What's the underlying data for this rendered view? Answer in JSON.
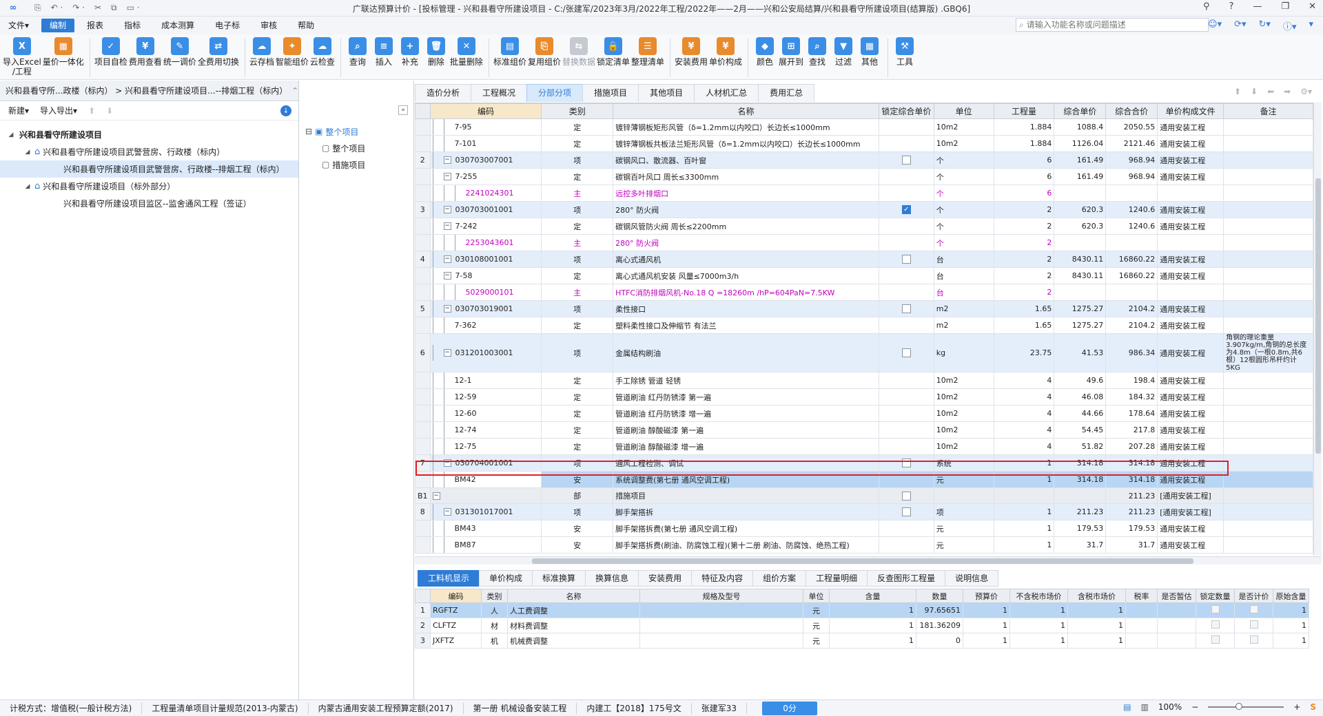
{
  "titlebar": {
    "title": "广联达预算计价 - [投标管理 - 兴和县看守所建设项目 - C:/张建军/2023年3月/2022年工程/2022年——2月——兴和公安局结算/兴和县看守所建设项目(结算版) .GBQ6]",
    "quick_access": [
      "⎘",
      "↶ ·",
      "↷ ·",
      "✂",
      "⧉",
      "▭ ·"
    ],
    "window_buttons": [
      "⚲",
      "?",
      "—",
      "❐",
      "✕"
    ]
  },
  "menu": {
    "items": [
      "文件▾",
      "编制",
      "报表",
      "指标",
      "成本测算",
      "电子标",
      "审核",
      "帮助"
    ],
    "active_index": 1
  },
  "search": {
    "placeholder": "请输入功能名称或问题描述"
  },
  "top_icons": [
    "☺▾",
    "⟳▾",
    "↻▾",
    "ⓘ▾",
    "▾"
  ],
  "toolbar": {
    "buttons": [
      {
        "label": "导入Excel\n/工程",
        "icon": "X",
        "color": "#3a8ee6"
      },
      {
        "label": "量价一体化",
        "icon": "▦",
        "color": "#e98a2c"
      },
      {
        "sep": true
      },
      {
        "label": "项目自检",
        "icon": "✓",
        "color": "#3a8ee6"
      },
      {
        "label": "费用查看",
        "icon": "¥",
        "color": "#3a8ee6"
      },
      {
        "label": "统一调价",
        "icon": "✎",
        "color": "#3a8ee6"
      },
      {
        "label": "全费用切换",
        "icon": "⇄",
        "color": "#3a8ee6"
      },
      {
        "sep": true
      },
      {
        "label": "云存档",
        "icon": "☁",
        "color": "#3a8ee6"
      },
      {
        "label": "智能组价",
        "icon": "✦",
        "color": "#e98a2c"
      },
      {
        "label": "云检查",
        "icon": "☁",
        "color": "#3a8ee6"
      },
      {
        "sep": true
      },
      {
        "label": "查询",
        "icon": "⌕",
        "color": "#3a8ee6"
      },
      {
        "label": "插入",
        "icon": "≡",
        "color": "#3a8ee6"
      },
      {
        "label": "补充",
        "icon": "+",
        "color": "#3a8ee6"
      },
      {
        "label": "删除",
        "icon": "🗑",
        "color": "#3a8ee6"
      },
      {
        "label": "批量删除",
        "icon": "✕",
        "color": "#3a8ee6"
      },
      {
        "sep": true
      },
      {
        "label": "标准组价",
        "icon": "▤",
        "color": "#3a8ee6"
      },
      {
        "label": "复用组价",
        "icon": "⎘",
        "color": "#e98a2c"
      },
      {
        "label": "替换数据",
        "icon": "⇆",
        "color": "#c5cad2",
        "disabled": true
      },
      {
        "label": "锁定清单",
        "icon": "🔒",
        "color": "#3a8ee6"
      },
      {
        "label": "整理清单",
        "icon": "☰",
        "color": "#e98a2c"
      },
      {
        "sep": true
      },
      {
        "label": "安装费用",
        "icon": "¥",
        "color": "#e98a2c"
      },
      {
        "label": "单价构成",
        "icon": "¥",
        "color": "#e98a2c"
      },
      {
        "sep": true
      },
      {
        "label": "颜色",
        "icon": "◆",
        "color": "#3a8ee6"
      },
      {
        "label": "展开到",
        "icon": "⊞",
        "color": "#3a8ee6"
      },
      {
        "label": "查找",
        "icon": "⌕",
        "color": "#3a8ee6"
      },
      {
        "label": "过滤",
        "icon": "▼",
        "color": "#3a8ee6"
      },
      {
        "label": "其他",
        "icon": "▦",
        "color": "#3a8ee6"
      },
      {
        "sep": true
      },
      {
        "label": "工具",
        "icon": "⚒",
        "color": "#3a8ee6"
      }
    ]
  },
  "left_panel": {
    "breadcrumb": "兴和县看守所...政楼（标内） > 兴和县看守所建设项目...--排烟工程（标内）",
    "toolbar": [
      "新建▾",
      "导入导出▾",
      "⬆",
      "⬇"
    ],
    "tree": [
      {
        "label": "兴和县看守所建设项目",
        "level": 0,
        "toggle": "◢",
        "icon": "",
        "bold": true
      },
      {
        "label": "兴和县看守所建设项目武警营房、行政楼（标内）",
        "level": 1,
        "toggle": "◢",
        "icon": "⌂"
      },
      {
        "label": "兴和县看守所建设项目武警营房、行政楼--排烟工程（标内）",
        "level": 2,
        "toggle": "",
        "icon": "",
        "selected": true
      },
      {
        "label": "兴和县看守所建设项目（标外部分）",
        "level": 1,
        "toggle": "◢",
        "icon": "⌂"
      },
      {
        "label": "兴和县看守所建设项目监区--监舍通风工程（签证）",
        "level": 2,
        "toggle": "",
        "icon": ""
      }
    ]
  },
  "nav_panel": {
    "collapse": "«",
    "items": [
      {
        "label": "整个项目",
        "level": 0,
        "toggle": "⊟",
        "active": true
      },
      {
        "label": "整个项目",
        "level": 1
      },
      {
        "label": "措施项目",
        "level": 1
      }
    ]
  },
  "main_tabs": [
    "造价分析",
    "工程概况",
    "分部分项",
    "措施项目",
    "其他项目",
    "人材机汇总",
    "费用汇总"
  ],
  "main_tabs_active": 2,
  "tab_right_icons": [
    "⬆",
    "⬇",
    "⬅",
    "➡",
    "⚙▾"
  ],
  "grid": {
    "columns": [
      "",
      "编码",
      "类别",
      "名称",
      "锁定综合单价",
      "单位",
      "工程量",
      "综合单价",
      "综合合价",
      "单价构成文件",
      "备注"
    ],
    "rows": [
      {
        "no": "",
        "code": "7-95",
        "kind": "定",
        "name": "镀锌薄钢板矩形风管（δ=1.2mm以内咬口）长边长≤1000mm",
        "lock": null,
        "unit": "10m2",
        "qty": "1.884",
        "price": "1088.4",
        "total": "2050.55",
        "file": "通用安装工程",
        "note": "",
        "type": "de",
        "indent": 2
      },
      {
        "no": "",
        "code": "7-101",
        "kind": "定",
        "name": "镀锌薄钢板共板法兰矩形风管（δ=1.2mm以内咬口）长边长≤1000mm",
        "lock": null,
        "unit": "10m2",
        "qty": "1.884",
        "price": "1126.04",
        "total": "2121.46",
        "file": "通用安装工程",
        "note": "",
        "type": "de",
        "indent": 2
      },
      {
        "no": "2",
        "code": "030703007001",
        "kind": "项",
        "name": "碳钢风口、散流器、百叶窗",
        "lock": false,
        "unit": "个",
        "qty": "6",
        "price": "161.49",
        "total": "968.94",
        "file": "通用安装工程",
        "note": "",
        "type": "qd",
        "indent": 1
      },
      {
        "no": "",
        "code": "7-255",
        "kind": "定",
        "name": "碳钢百叶风口 周长≤3300mm",
        "lock": null,
        "unit": "个",
        "qty": "6",
        "price": "161.49",
        "total": "968.94",
        "file": "通用安装工程",
        "note": "",
        "type": "de",
        "indent": 2,
        "box": true
      },
      {
        "no": "",
        "code": "2241024301",
        "kind": "主",
        "name": "远控多叶排烟口",
        "lock": null,
        "unit": "个",
        "qty": "6",
        "price": "",
        "total": "",
        "file": "",
        "note": "",
        "type": "main",
        "indent": 3
      },
      {
        "no": "3",
        "code": "030703001001",
        "kind": "项",
        "name": "280° 防火阀",
        "lock": true,
        "unit": "个",
        "qty": "2",
        "price": "620.3",
        "total": "1240.6",
        "file": "通用安装工程",
        "note": "",
        "type": "qd",
        "indent": 1
      },
      {
        "no": "",
        "code": "7-242",
        "kind": "定",
        "name": "碳钢风管防火阀 周长≤2200mm",
        "lock": null,
        "unit": "个",
        "qty": "2",
        "price": "620.3",
        "total": "1240.6",
        "file": "通用安装工程",
        "note": "",
        "type": "de",
        "indent": 2,
        "box": true
      },
      {
        "no": "",
        "code": "2253043601",
        "kind": "主",
        "name": "280° 防火阀",
        "lock": null,
        "unit": "个",
        "qty": "2",
        "price": "",
        "total": "",
        "file": "",
        "note": "",
        "type": "main",
        "indent": 3
      },
      {
        "no": "4",
        "code": "030108001001",
        "kind": "项",
        "name": "离心式通风机",
        "lock": false,
        "unit": "台",
        "qty": "2",
        "price": "8430.11",
        "total": "16860.22",
        "file": "通用安装工程",
        "note": "",
        "type": "qd",
        "indent": 1
      },
      {
        "no": "",
        "code": "7-58",
        "kind": "定",
        "name": "离心式通风机安装 风量≤7000m3/h",
        "lock": null,
        "unit": "台",
        "qty": "2",
        "price": "8430.11",
        "total": "16860.22",
        "file": "通用安装工程",
        "note": "",
        "type": "de",
        "indent": 2,
        "box": true
      },
      {
        "no": "",
        "code": "5029000101",
        "kind": "主",
        "name": "HTFC消防排烟风机-No.18 Q =18260m /hP=604PaN=7.5KW",
        "lock": null,
        "unit": "台",
        "qty": "2",
        "price": "",
        "total": "",
        "file": "",
        "note": "",
        "type": "main",
        "indent": 3
      },
      {
        "no": "5",
        "code": "030703019001",
        "kind": "项",
        "name": "柔性接口",
        "lock": false,
        "unit": "m2",
        "qty": "1.65",
        "price": "1275.27",
        "total": "2104.2",
        "file": "通用安装工程",
        "note": "",
        "type": "qd",
        "indent": 1
      },
      {
        "no": "",
        "code": "7-362",
        "kind": "定",
        "name": "塑料柔性接口及伸缩节 有法兰",
        "lock": null,
        "unit": "m2",
        "qty": "1.65",
        "price": "1275.27",
        "total": "2104.2",
        "file": "通用安装工程",
        "note": "",
        "type": "de",
        "indent": 2
      },
      {
        "no": "6",
        "code": "031201003001",
        "kind": "项",
        "name": "金属结构刷油",
        "lock": false,
        "unit": "kg",
        "qty": "23.75",
        "price": "41.53",
        "total": "986.34",
        "file": "通用安装工程",
        "note": "角钢的理论重量3.907kg/m,角钢的总长度为4.8m（一根0.8m,共6根）12根圆形吊杆约计5KG",
        "type": "qd",
        "indent": 1,
        "tall": true
      },
      {
        "no": "",
        "code": "12-1",
        "kind": "定",
        "name": "手工除锈 管道 轻锈",
        "lock": null,
        "unit": "10m2",
        "qty": "4",
        "price": "49.6",
        "total": "198.4",
        "file": "通用安装工程",
        "note": "",
        "type": "de",
        "indent": 2
      },
      {
        "no": "",
        "code": "12-59",
        "kind": "定",
        "name": "管道刷油 红丹防锈漆 第一遍",
        "lock": null,
        "unit": "10m2",
        "qty": "4",
        "price": "46.08",
        "total": "184.32",
        "file": "通用安装工程",
        "note": "",
        "type": "de",
        "indent": 2
      },
      {
        "no": "",
        "code": "12-60",
        "kind": "定",
        "name": "管道刷油 红丹防锈漆 增一遍",
        "lock": null,
        "unit": "10m2",
        "qty": "4",
        "price": "44.66",
        "total": "178.64",
        "file": "通用安装工程",
        "note": "",
        "type": "de",
        "indent": 2
      },
      {
        "no": "",
        "code": "12-74",
        "kind": "定",
        "name": "管道刷油 醇酸磁漆 第一遍",
        "lock": null,
        "unit": "10m2",
        "qty": "4",
        "price": "54.45",
        "total": "217.8",
        "file": "通用安装工程",
        "note": "",
        "type": "de",
        "indent": 2
      },
      {
        "no": "",
        "code": "12-75",
        "kind": "定",
        "name": "管道刷油 醇酸磁漆 增一遍",
        "lock": null,
        "unit": "10m2",
        "qty": "4",
        "price": "51.82",
        "total": "207.28",
        "file": "通用安装工程",
        "note": "",
        "type": "de",
        "indent": 2
      },
      {
        "no": "7",
        "code": "030704001001",
        "kind": "项",
        "name": "通风工程检测、调试",
        "lock": false,
        "unit": "系统",
        "qty": "1",
        "price": "314.18",
        "total": "314.18",
        "file": "通用安装工程",
        "note": "",
        "type": "qd",
        "indent": 1
      },
      {
        "no": "",
        "code": "BM42",
        "kind": "安",
        "name": "系统调整费(第七册 通风空调工程)",
        "lock": null,
        "unit": "元",
        "qty": "1",
        "price": "314.18",
        "total": "314.18",
        "file": "通用安装工程",
        "note": "",
        "type": "sel",
        "indent": 2
      },
      {
        "no": "B1",
        "code": "",
        "kind": "部",
        "name": "措施项目",
        "lock": false,
        "unit": "",
        "qty": "",
        "price": "",
        "total": "211.23",
        "file": "[通用安装工程]",
        "note": "",
        "type": "bu",
        "indent": 0
      },
      {
        "no": "8",
        "code": "031301017001",
        "kind": "项",
        "name": "脚手架搭拆",
        "lock": false,
        "unit": "项",
        "qty": "1",
        "price": "211.23",
        "total": "211.23",
        "file": "[通用安装工程]",
        "note": "",
        "type": "qd",
        "indent": 1
      },
      {
        "no": "",
        "code": "BM43",
        "kind": "安",
        "name": "脚手架搭拆费(第七册 通风空调工程)",
        "lock": null,
        "unit": "元",
        "qty": "1",
        "price": "179.53",
        "total": "179.53",
        "file": "通用安装工程",
        "note": "",
        "type": "de",
        "indent": 2
      },
      {
        "no": "",
        "code": "BM87",
        "kind": "安",
        "name": "脚手架搭拆费(刷油、防腐蚀工程)(第十二册 刷油、防腐蚀、绝热工程)",
        "lock": null,
        "unit": "元",
        "qty": "1",
        "price": "31.7",
        "total": "31.7",
        "file": "通用安装工程",
        "note": "",
        "type": "de",
        "indent": 2
      }
    ]
  },
  "bottom_tabs": [
    "工料机显示",
    "单价构成",
    "标准换算",
    "换算信息",
    "安装费用",
    "特征及内容",
    "组价方案",
    "工程量明细",
    "反查图形工程量",
    "说明信息"
  ],
  "bottom_tabs_active": 0,
  "grid2": {
    "columns": [
      "",
      "编码",
      "类别",
      "名称",
      "规格及型号",
      "单位",
      "含量",
      "数量",
      "预算价",
      "不含税市场价",
      "含税市场价",
      "税率",
      "是否暂估",
      "锁定数量",
      "是否计价",
      "原始含量"
    ],
    "rows": [
      {
        "no": "1",
        "code": "RGFTZ",
        "kind": "人",
        "name": "人工费调整",
        "spec": "",
        "unit": "元",
        "content": "1",
        "qty": "97.65651",
        "budget": "1",
        "mkt_notax": "1",
        "mkt_tax": "1",
        "tax": "",
        "orig": "1",
        "selected": true
      },
      {
        "no": "2",
        "code": "CLFTZ",
        "kind": "材",
        "name": "材料费调整",
        "spec": "",
        "unit": "元",
        "content": "1",
        "qty": "181.36209",
        "budget": "1",
        "mkt_notax": "1",
        "mkt_tax": "1",
        "tax": "",
        "orig": "1"
      },
      {
        "no": "3",
        "code": "JXFTZ",
        "kind": "机",
        "name": "机械费调整",
        "spec": "",
        "unit": "元",
        "content": "1",
        "qty": "0",
        "budget": "1",
        "mkt_notax": "1",
        "mkt_tax": "1",
        "tax": "",
        "orig": "1"
      }
    ]
  },
  "status": {
    "items": [
      "计税方式：增值税(一般计税方法)",
      "工程量清单项目计量规范(2013-内蒙古)",
      "内蒙古通用安装工程预算定额(2017)",
      "第一册 机械设备安装工程",
      "内建工【2018】175号文",
      "张建军33"
    ],
    "badge": "0分",
    "zoom": "100%"
  }
}
